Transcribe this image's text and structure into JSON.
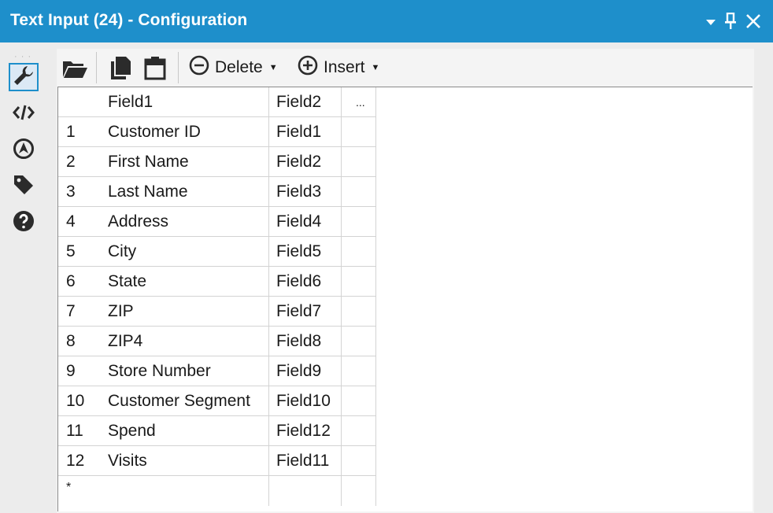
{
  "window": {
    "title": "Text Input (24) - Configuration",
    "controls": {
      "dropdown_icon": "chevron-down-icon",
      "pin_icon": "pin-icon",
      "close_icon": "close-icon"
    }
  },
  "sidebar": {
    "items": [
      {
        "name": "configuration",
        "icon": "wrench-icon",
        "active": true
      },
      {
        "name": "annotation-xml",
        "icon": "code-icon"
      },
      {
        "name": "navigate",
        "icon": "compass-icon"
      },
      {
        "name": "tag",
        "icon": "tag-icon"
      },
      {
        "name": "help",
        "icon": "help-icon"
      }
    ]
  },
  "toolbar": {
    "open_icon": "folder-open-icon",
    "copy_icon": "copy-icon",
    "paste_icon": "clipboard-icon",
    "delete_label": "Delete",
    "insert_label": "Insert"
  },
  "grid": {
    "columns": [
      "Field1",
      "Field2",
      "..."
    ],
    "rows": [
      {
        "num": "1",
        "field1": "Customer ID",
        "field2": "Field1"
      },
      {
        "num": "2",
        "field1": "First Name",
        "field2": "Field2"
      },
      {
        "num": "3",
        "field1": "Last Name",
        "field2": "Field3"
      },
      {
        "num": "4",
        "field1": "Address",
        "field2": "Field4"
      },
      {
        "num": "5",
        "field1": "City",
        "field2": "Field5"
      },
      {
        "num": "6",
        "field1": "State",
        "field2": "Field6"
      },
      {
        "num": "7",
        "field1": "ZIP",
        "field2": "Field7"
      },
      {
        "num": "8",
        "field1": "ZIP4",
        "field2": "Field8"
      },
      {
        "num": "9",
        "field1": "Store Number",
        "field2": "Field9"
      },
      {
        "num": "10",
        "field1": "Customer Segment",
        "field2": "Field10"
      },
      {
        "num": "11",
        "field1": "Spend",
        "field2": "Field12"
      },
      {
        "num": "12",
        "field1": "Visits",
        "field2": "Field11"
      }
    ],
    "new_row_marker": "*"
  },
  "colors": {
    "titlebar": "#1e8fcb",
    "accent": "#1e8fcb"
  }
}
